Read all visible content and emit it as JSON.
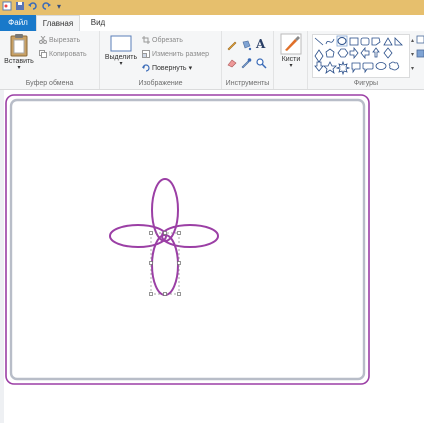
{
  "tabs": {
    "file": "Файл",
    "home": "Главная",
    "view": "Вид"
  },
  "clipboard": {
    "paste": "Вставить",
    "cut": "Вырезать",
    "copy": "Копировать",
    "label": "Буфер обмена"
  },
  "image": {
    "select": "Выделить",
    "crop": "Обрезать",
    "resize": "Изменить размер",
    "rotate": "Повернуть",
    "label": "Изображение"
  },
  "tools": {
    "label": "Инструменты"
  },
  "brushes": {
    "label": "Кисти"
  },
  "shapes": {
    "label": "Фигуры"
  },
  "colors": {
    "accent": "#1979ca",
    "titlebar": "#e6bf6d",
    "shape_outline": "#9b3fa5",
    "frame_outer": "#9b3fa5",
    "frame_inner": "#b8bdc8"
  }
}
